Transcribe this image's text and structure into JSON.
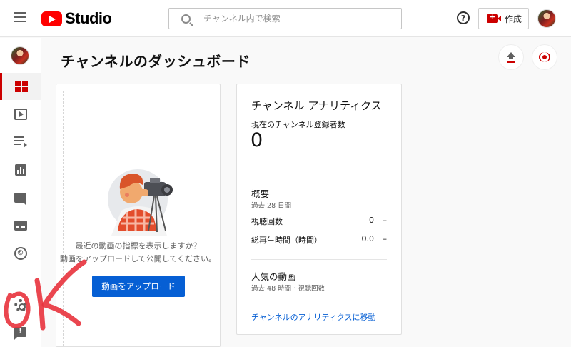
{
  "header": {
    "logo_text": "Studio",
    "search_placeholder": "チャンネル内で検索",
    "help_glyph": "?",
    "create_label": "作成"
  },
  "sidebar": {
    "items": [
      {
        "name": "dashboard",
        "icon": "dashboard-icon",
        "active": true
      },
      {
        "name": "content",
        "icon": "video-icon"
      },
      {
        "name": "playlists",
        "icon": "playlist-icon"
      },
      {
        "name": "analytics",
        "icon": "analytics-icon"
      },
      {
        "name": "comments",
        "icon": "comment-icon"
      },
      {
        "name": "subtitles",
        "icon": "subtitles-icon"
      },
      {
        "name": "copyright",
        "icon": "copyright-icon",
        "glyph": "©"
      },
      {
        "name": "settings",
        "icon": "gear-icon"
      },
      {
        "name": "feedback",
        "icon": "feedback-icon",
        "glyph": "!"
      }
    ]
  },
  "main": {
    "title": "チャンネルのダッシュボード",
    "upload_card": {
      "line1": "最近の動画の指標を表示しますか？",
      "line2": "動画をアップロードして公開してください。",
      "button": "動画をアップロード"
    },
    "analytics": {
      "title": "チャンネル アナリティクス",
      "subscribers_label": "現在のチャンネル登録者数",
      "subscribers_value": "0",
      "summary_title": "概要",
      "summary_period": "過去 28 日間",
      "rows": [
        {
          "label": "視聴回数",
          "value": "0",
          "trend": "–"
        },
        {
          "label": "総再生時間（時間）",
          "value": "0.0",
          "trend": "–"
        }
      ],
      "popular_title": "人気の動画",
      "popular_period": "過去 48 時間 · 視聴回数",
      "link": "チャンネルのアナリティクスに移動"
    }
  },
  "colors": {
    "brand_red": "#ff0000",
    "accent_blue": "#065fd4",
    "annotation_red": "#e8323c"
  }
}
